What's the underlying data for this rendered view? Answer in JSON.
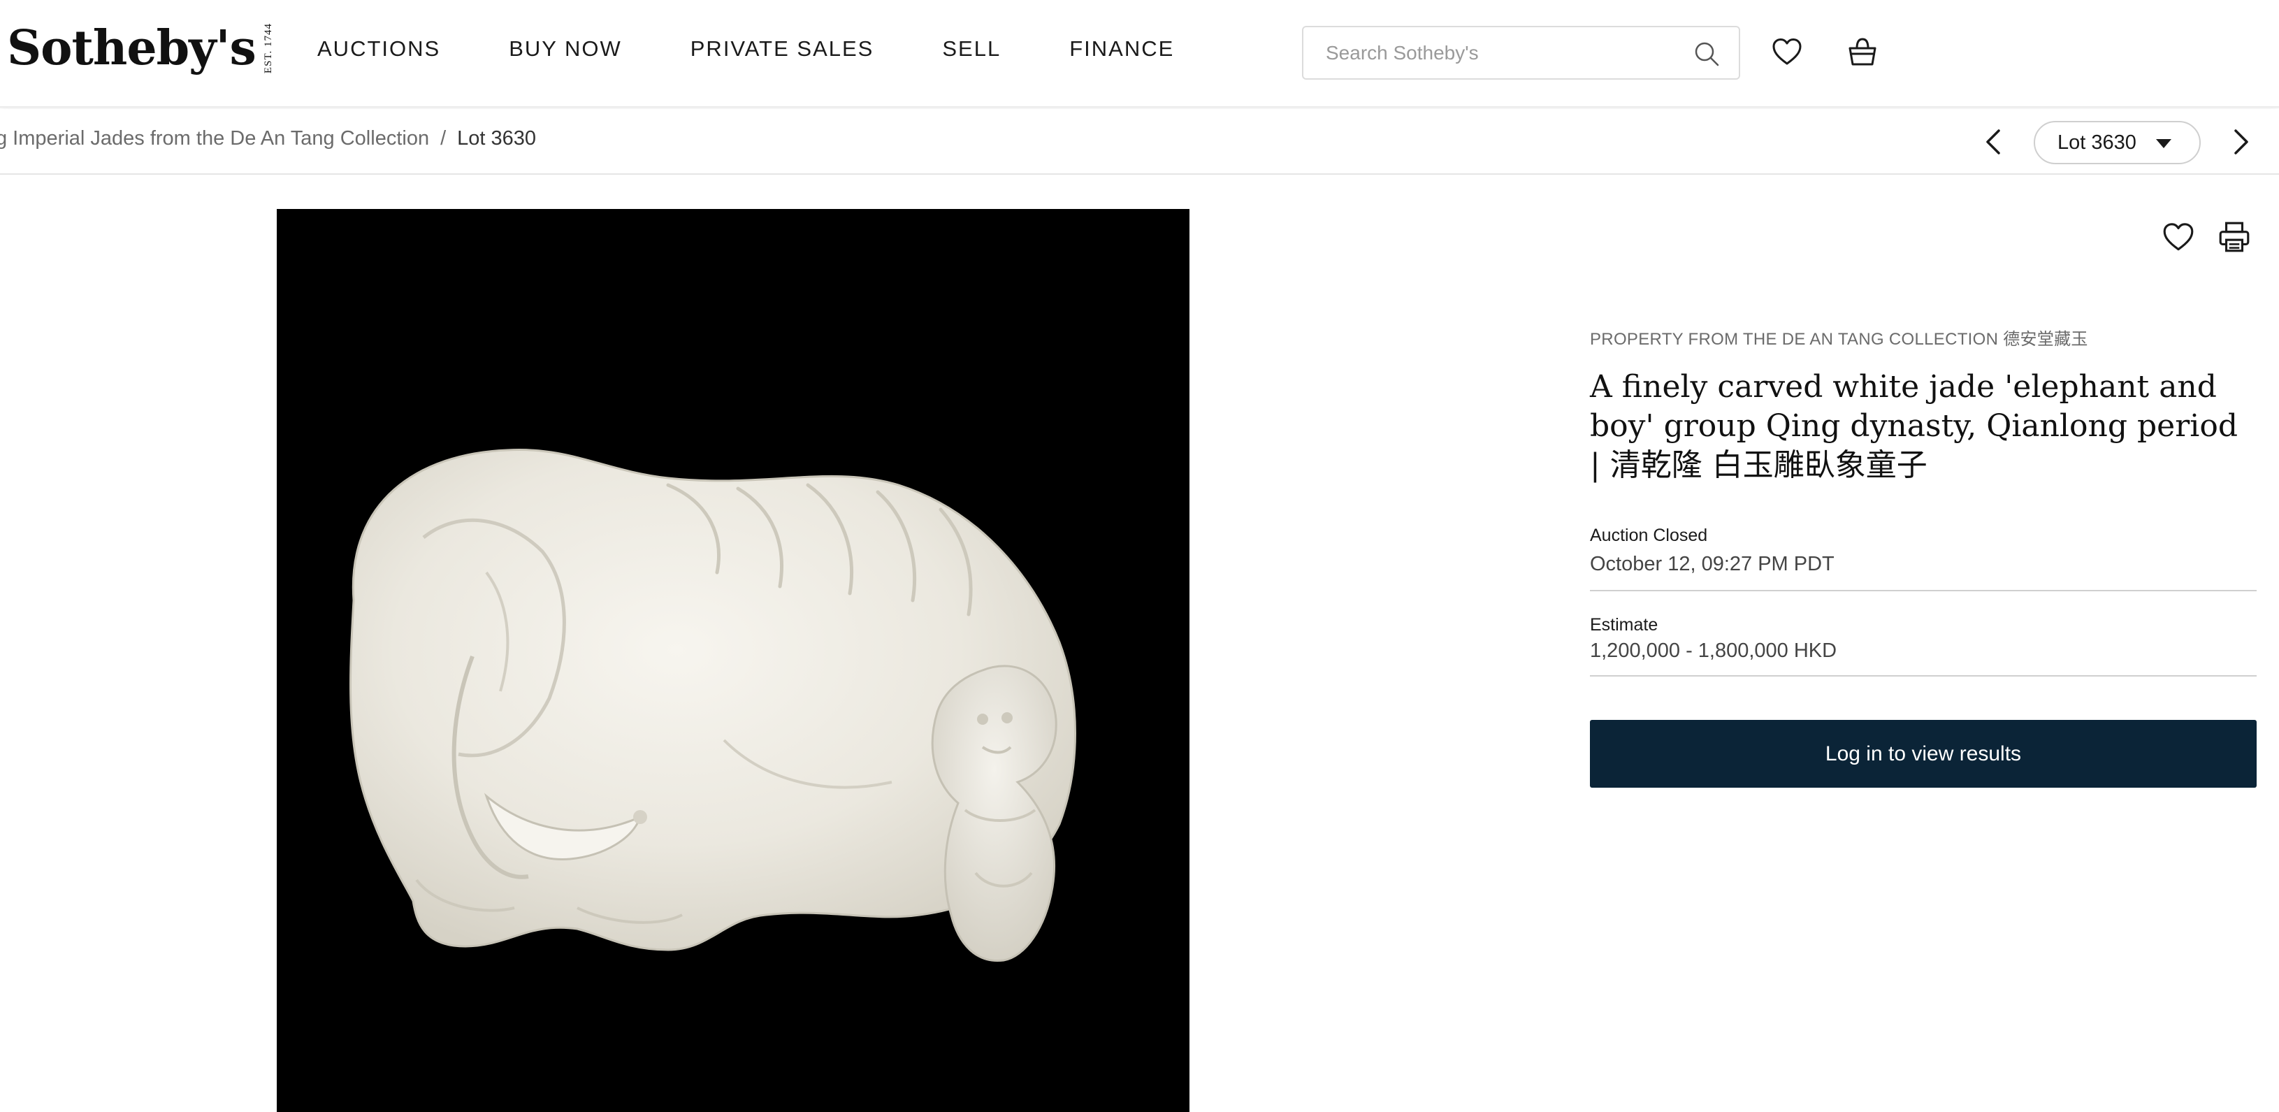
{
  "header": {
    "logo_text": "Sotheby's",
    "logo_est": "EST. 1744",
    "nav": [
      "AUCTIONS",
      "BUY NOW",
      "PRIVATE SALES",
      "SELL",
      "FINANCE"
    ],
    "search_placeholder": "Search Sotheby's"
  },
  "breadcrumb": {
    "parent": "g Imperial Jades from the De An Tang Collection",
    "separator": "/",
    "current": "Lot 3630"
  },
  "lot_nav": {
    "selected": "Lot 3630"
  },
  "lot": {
    "provenance": "PROPERTY FROM THE DE AN TANG COLLECTION 德安堂藏玉",
    "title": "A finely carved white jade 'elephant and boy' group Qing dynasty, Qianlong period | 清乾隆 白玉雕臥象童子",
    "auction_status_label": "Auction Closed",
    "auction_closed_time": "October 12, 09:27 PM PDT",
    "estimate_label": "Estimate",
    "estimate_value": "1,200,000 - 1,800,000 HKD",
    "cta_label": "Log in to view results"
  },
  "colors": {
    "cta_background": "#0b2437",
    "image_background": "#000000"
  }
}
